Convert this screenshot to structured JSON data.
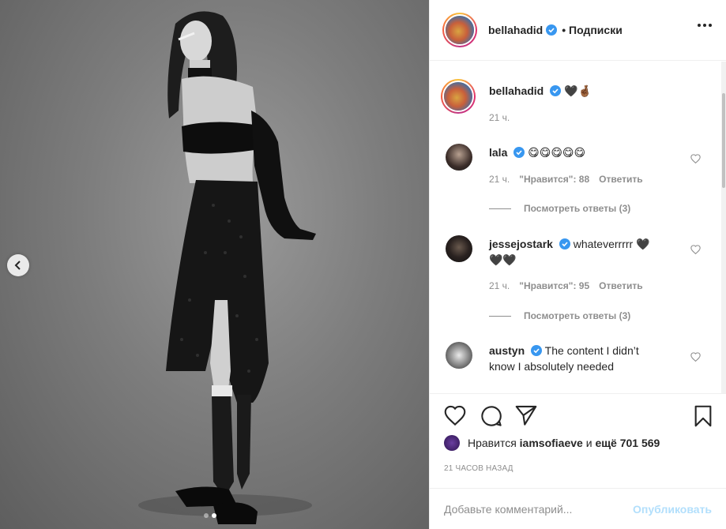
{
  "post": {
    "author": "bellahadid",
    "follow_text": "• Подписки",
    "caption_emoji": "🖤🤞🏾",
    "caption_time": "21 ч."
  },
  "media": {
    "carousel_dots": 2,
    "active_dot": 1
  },
  "comments": [
    {
      "user": "lala",
      "text": "😋😋😋😋😋",
      "time": "21 ч.",
      "likes": "\"Нравится\": 88",
      "reply": "Ответить",
      "view_replies": "Посмотреть ответы (3)"
    },
    {
      "user": "jessejostark",
      "text": "whateverrrrr 🖤",
      "text_line2": "🖤🖤",
      "time": "21 ч.",
      "likes": "\"Нравится\": 95",
      "reply": "Ответить",
      "view_replies": "Посмотреть ответы (3)"
    },
    {
      "user": "austyn",
      "text": "The content I didn’t",
      "text_line2": "know I absolutely needed"
    }
  ],
  "likes_line": {
    "prefix": "Нравится",
    "user": "iamsofiaeve",
    "connector": "и",
    "count": "ещё 701 569"
  },
  "timestamp": "21 ЧАСОВ НАЗАД",
  "add_comment": {
    "placeholder": "Добавьте комментарий...",
    "publish": "Опубликовать"
  },
  "colors": {
    "verified": "#3897f0",
    "publish_disabled": "#b2dffc",
    "muted": "#8e8e8e"
  }
}
